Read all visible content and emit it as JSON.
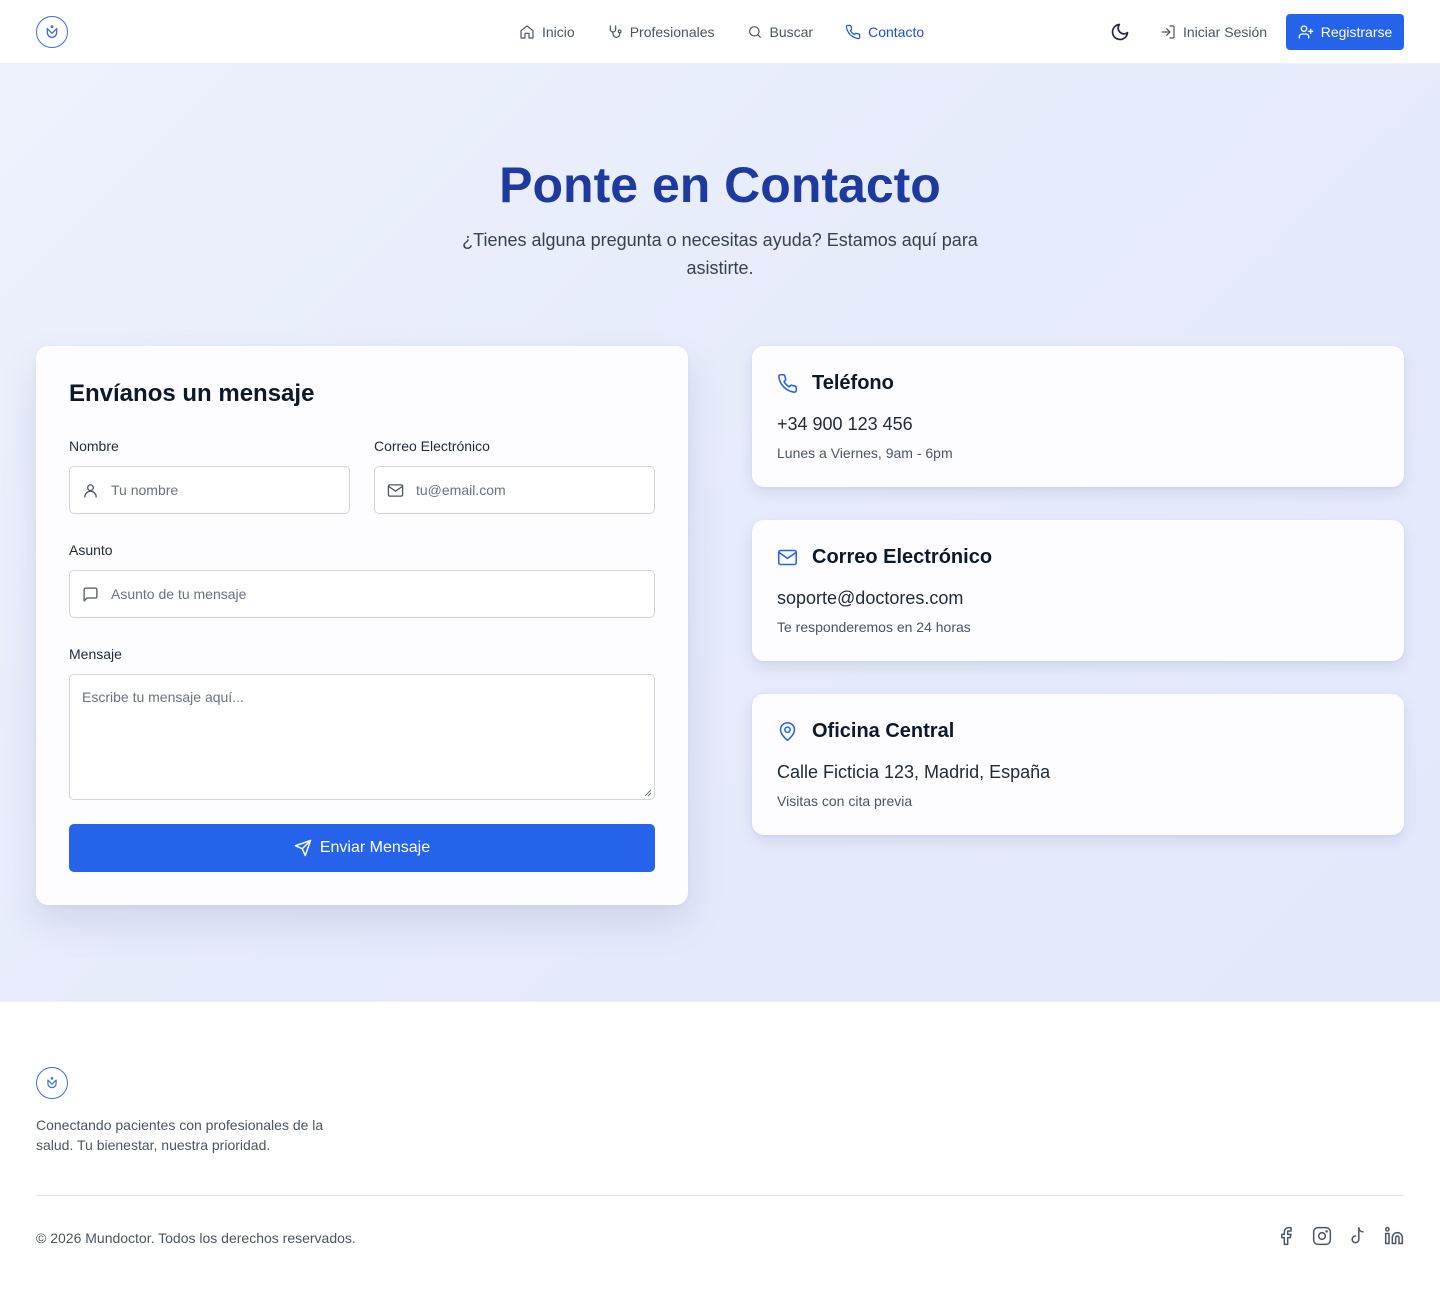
{
  "nav": {
    "items": [
      {
        "label": "Inicio",
        "icon": "home-icon"
      },
      {
        "label": "Profesionales",
        "icon": "stethoscope-icon"
      },
      {
        "label": "Buscar",
        "icon": "search-icon"
      },
      {
        "label": "Contacto",
        "icon": "phone-icon",
        "active": true
      }
    ],
    "theme_icon": "moon-icon",
    "login_label": "Iniciar Sesión",
    "register_label": "Registrarse"
  },
  "hero": {
    "title": "Ponte en Contacto",
    "subtitle": "¿Tienes alguna pregunta o necesitas ayuda? Estamos aquí para asistirte."
  },
  "form": {
    "title": "Envíanos un mensaje",
    "name_label": "Nombre",
    "name_placeholder": "Tu nombre",
    "email_label": "Correo Electrónico",
    "email_placeholder": "tu@email.com",
    "subject_label": "Asunto",
    "subject_placeholder": "Asunto de tu mensaje",
    "message_label": "Mensaje",
    "message_placeholder": "Escribe tu mensaje aquí...",
    "submit_label": "Enviar Mensaje"
  },
  "contact_cards": [
    {
      "icon": "phone-icon",
      "title": "Teléfono",
      "value": "+34 900 123 456",
      "note": "Lunes a Viernes, 9am - 6pm"
    },
    {
      "icon": "mail-icon",
      "title": "Correo Electrónico",
      "value": "soporte@doctores.com",
      "note": "Te responderemos en 24 horas"
    },
    {
      "icon": "map-pin-icon",
      "title": "Oficina Central",
      "value": "Calle Ficticia 123, Madrid, España",
      "note": "Visitas con cita previa"
    }
  ],
  "footer": {
    "tagline": "Conectando pacientes con profesionales de la salud. Tu bienestar, nuestra prioridad.",
    "copyright": "© 2026 Mundoctor. Todos los derechos reservados.",
    "socials": [
      "facebook-icon",
      "instagram-icon",
      "tiktok-icon",
      "linkedin-icon"
    ]
  },
  "colors": {
    "primary": "#2563eb",
    "heading": "#1e3a9e",
    "background": "#eef2fd"
  }
}
